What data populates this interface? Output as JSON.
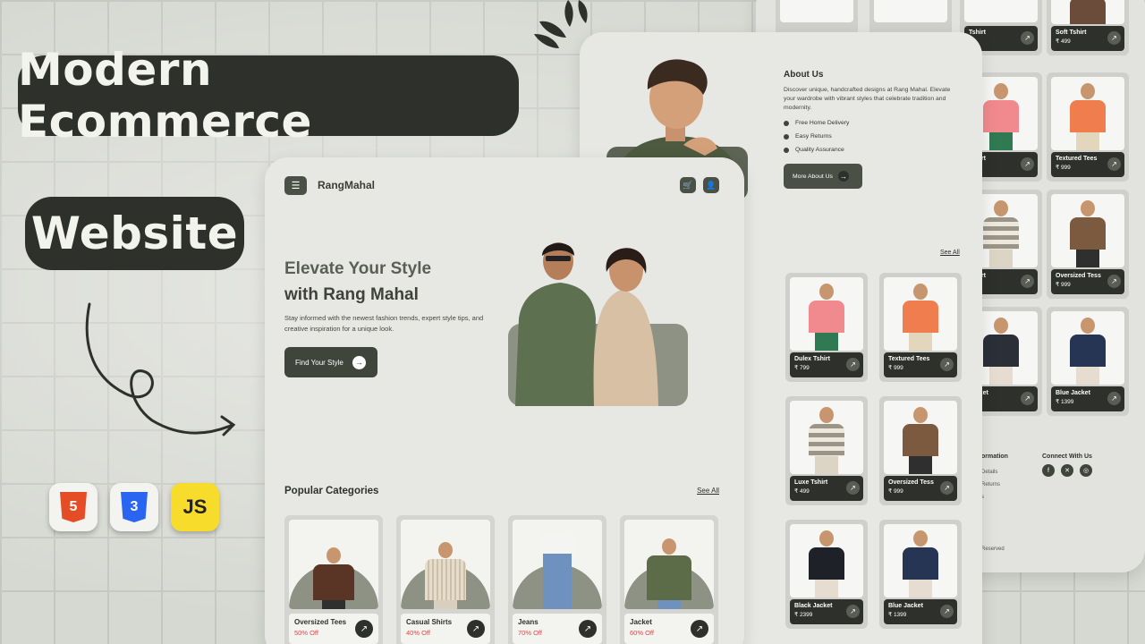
{
  "banner": {
    "title_line1": "Modern Ecommerce",
    "title_line2": "Website",
    "tech": {
      "html": "5",
      "css": "3",
      "js": "JS"
    }
  },
  "front": {
    "brand": "RangMahal",
    "hero": {
      "line1": "Elevate Your Style",
      "line2": "with Rang Mahal",
      "description": "Stay informed with the newest fashion trends, expert style tips, and creative inspiration for a unique look.",
      "cta": "Find Your Style"
    },
    "section_title": "Popular Categories",
    "see_all": "See All",
    "categories": [
      {
        "name": "Oversized Tees",
        "offer": "50% Off"
      },
      {
        "name": "Casual Shirts",
        "offer": "40% Off"
      },
      {
        "name": "Jeans",
        "offer": "70% Off"
      },
      {
        "name": "Jacket",
        "offer": "60% Off"
      }
    ]
  },
  "about": {
    "title": "About Us",
    "text": "Discover unique, handcrafted designs at Rang Mahal. Elevate your wardrobe with vibrant styles that celebrate tradition and modernity.",
    "features": [
      "Free Home Delivery",
      "Easy Returns",
      "Quality Assurance"
    ],
    "button": "More About Us",
    "see_all": "See All",
    "products": [
      {
        "name": "Dulex Tshirt",
        "price": "₹ 799"
      },
      {
        "name": "Textured Tees",
        "price": "₹ 999"
      },
      {
        "name": "Luxe Tshirt",
        "price": "₹ 499"
      },
      {
        "name": "Oversized Tess",
        "price": "₹ 999"
      },
      {
        "name": "Black Jacket",
        "price": "₹ 2399"
      },
      {
        "name": "Blue Jacket",
        "price": "₹ 1399"
      }
    ]
  },
  "back": {
    "products": [
      {
        "name": "Soft Tshirt",
        "price": "₹ 499"
      },
      {
        "name": "Textured Tees",
        "price": "₹ 999"
      },
      {
        "name": "Oversized Tess",
        "price": "₹ 999"
      },
      {
        "name": "Blue Jacket",
        "price": "₹ 1399"
      }
    ],
    "partial": [
      "Tshirt",
      "Tshirt",
      "Tshirt",
      "Jacket"
    ],
    "footer": {
      "info_title": "ormation",
      "info_items": [
        "Details",
        "Returns",
        "s"
      ],
      "connect_title": "Connect With Us",
      "rights": "Reserved"
    }
  }
}
